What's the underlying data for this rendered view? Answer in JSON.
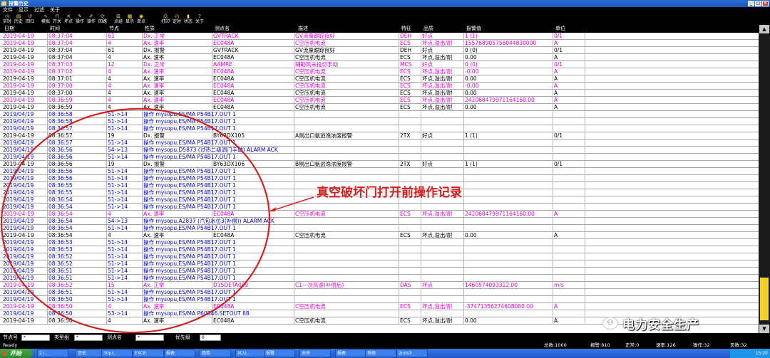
{
  "window": {
    "title": "报警历史",
    "controls": [
      "_",
      "□",
      "×"
    ]
  },
  "menu": [
    "文件",
    "显示",
    "过滤",
    "关于"
  ],
  "toolbar": [
    {
      "label": "实时",
      "icon": "realtime-icon"
    },
    {
      "label": "历史",
      "icon": "history-icon"
    },
    {
      "label": "回归",
      "icon": "replay-icon"
    },
    {
      "label": "模拟",
      "icon": "simulate-icon"
    },
    {
      "label": "开关",
      "icon": "switch-icon"
    },
    {
      "label": "坏点",
      "icon": "bad-point-icon"
    },
    {
      "label": "操作",
      "icon": "operate-icon"
    },
    {
      "label": "操作",
      "icon": "operate2-icon"
    },
    {
      "label": "回路",
      "icon": "loop-icon"
    },
    {
      "label": "点组",
      "icon": "group-icon"
    },
    {
      "label": "显示",
      "icon": "display-icon"
    },
    {
      "label": "单点",
      "icon": "single-point-icon"
    },
    {
      "label": "打印",
      "icon": "print-icon"
    },
    {
      "label": "定时",
      "icon": "timer-icon"
    },
    {
      "label": "状态",
      "icon": "status-icon"
    },
    {
      "label": "关于",
      "icon": "about-icon"
    }
  ],
  "table": {
    "columns": [
      "日期",
      "时间",
      "节点",
      "性质",
      "测点名",
      "描述",
      "特征",
      "品质",
      "报警值",
      "单位"
    ],
    "rows": [
      {
        "c": "pink",
        "v": [
          "2019-04-19",
          "08:37:04",
          "61",
          "Dx. 正常",
          "GVTRACK",
          "GV流量跟踪良好",
          "DEH",
          "好点",
          "1 (1)",
          "0/1"
        ]
      },
      {
        "c": "pink",
        "v": [
          "2019-04-19",
          "08:37:04",
          "4",
          "Ax. 速率",
          "EC048A",
          "C空压机电流",
          "ECS",
          "坏点,溢出/耐",
          "155768905756044830000",
          "A"
        ]
      },
      {
        "c": "black",
        "v": [
          "2019-04-19",
          "08:37:04",
          "61",
          "Dx. 报警",
          "GVTRACK",
          "GV流量跟踪良好",
          "DEH",
          "好点",
          "0 (0)",
          "0/1"
        ]
      },
      {
        "c": "black",
        "v": [
          "2019-04-19",
          "08:37:04",
          "4",
          "Ax. 速率",
          "EC048A",
          "C空压机电流",
          "ECS",
          "坏点,溢出/耐",
          "0.00",
          "A"
        ]
      },
      {
        "c": "pink",
        "v": [
          "2019-04-19",
          "08:37:03",
          "12",
          "Dx. 正常",
          "AAMRE",
          "辅助风未投切手动",
          "MCS",
          "好点",
          "0 (0)",
          "0/1"
        ]
      },
      {
        "c": "pink",
        "v": [
          "2019-04-19",
          "08:37:02",
          "4",
          "Ax. 速率",
          "EC048A",
          "C空压机电流",
          "ECS",
          "坏点,溢出/耐",
          "-0.00",
          "A"
        ]
      },
      {
        "c": "black",
        "v": [
          "2019-04-19",
          "08:37:01",
          "4",
          "Ax. 速率",
          "EC048A",
          "C空压机电流",
          "ECS",
          "坏点,溢出/耐",
          "0.00",
          "A"
        ]
      },
      {
        "c": "pink",
        "v": [
          "2019-04-19",
          "08:37:00",
          "4",
          "Ax. 速率",
          "EC048A",
          "C空压机电流",
          "ECS",
          "坏点,溢出/耐",
          "-0.00",
          "A"
        ]
      },
      {
        "c": "black",
        "v": [
          "2019-04-19",
          "08:37:00",
          "4",
          "Ax. 速率",
          "EC048A",
          "C空压机电流",
          "ECS",
          "坏点,溢出/耐",
          "0.00",
          "A"
        ]
      },
      {
        "c": "pink",
        "v": [
          "2019-04-19",
          "08:36:59",
          "4",
          "Ax. 速率",
          "EC048A",
          "C空压机电流",
          "ECS",
          "坏点,溢出/耐",
          "242068479971164160.00",
          "A"
        ]
      },
      {
        "c": "black",
        "v": [
          "2019-04-19",
          "08:36:59",
          "4",
          "Ax. 速率",
          "EC048A",
          "C空压机电流",
          "ECS",
          "坏点,溢出/耐",
          "0.00",
          "A"
        ]
      },
      {
        "c": "blue",
        "v": [
          "2019/04/19",
          "08:36:58",
          "51->14",
          "操作 mysopu,ES/MA P54B17.OUT 1",
          "",
          "",
          "",
          "",
          "",
          ""
        ]
      },
      {
        "c": "blue",
        "v": [
          "2019/04/19",
          "08:36:58",
          "51->14",
          "操作 mysopu,ES/MA P54B17.OUT 1",
          "",
          "",
          "",
          "",
          "",
          ""
        ]
      },
      {
        "c": "blue",
        "v": [
          "2019/04/19",
          "08:36:57",
          "51->14",
          "操作 mysopu,ES/MA P54B17.OUT 1",
          "",
          "",
          "",
          "",
          "",
          ""
        ]
      },
      {
        "c": "black",
        "v": [
          "2019-04-19",
          "08:36:57",
          "19",
          "Dx. 报警",
          "BY63DX105",
          "A侧出口氨逃逸浓度报警",
          "2TX",
          "好点",
          "1 (1)",
          "0/1"
        ]
      },
      {
        "c": "blue",
        "v": [
          "2019/04/19",
          "08:36:57",
          "51->14",
          "操作 mysopu,ES/MA P54B17.OUT 1",
          "",
          "",
          "",
          "",
          "",
          ""
        ]
      },
      {
        "c": "blue",
        "v": [
          "2019/04/19",
          "08:36:56",
          "54->13",
          "操作 mysopu,D5873 (过热二级调门手动) ALARM ACK",
          "",
          "",
          "",
          "",
          "",
          ""
        ]
      },
      {
        "c": "blue",
        "v": [
          "2019/04/19",
          "08:36:56",
          "51->14",
          "操作 mysopu,ES/MA P54B17.OUT 1",
          "",
          "",
          "",
          "",
          "",
          ""
        ]
      },
      {
        "c": "black",
        "v": [
          "2019-04-19",
          "08:36:56",
          "19",
          "Dx. 报警",
          "BY63DX106",
          "B侧出口氨逃逸浓度报警",
          "2TX",
          "好点",
          "1 (1)",
          "0/1"
        ]
      },
      {
        "c": "blue",
        "v": [
          "2019/04/19",
          "08:36:56",
          "51->14",
          "操作 mysopu,ES/MA P54B17.OUT 1",
          "",
          "",
          "",
          "",
          "",
          ""
        ]
      },
      {
        "c": "blue",
        "v": [
          "2019/04/19",
          "08:36:56",
          "51->14",
          "操作 mysopu,ES/MA P54B17.OUT 1",
          "",
          "",
          "",
          "",
          "",
          ""
        ]
      },
      {
        "c": "blue",
        "v": [
          "2019/04/19",
          "08:36:55",
          "51->14",
          "操作 mysopu,ES/MA P54B17.OUT 1",
          "",
          "",
          "",
          "",
          "",
          ""
        ]
      },
      {
        "c": "blue",
        "v": [
          "2019/04/19",
          "08:36:55",
          "51->14",
          "操作 mysopu,ES/MA P54B17.OUT 1",
          "",
          "",
          "",
          "",
          "",
          ""
        ]
      },
      {
        "c": "blue",
        "v": [
          "2019/04/19",
          "08:36:54",
          "51->14",
          "操作 mysopu,ES/MA P54B17.OUT 1",
          "",
          "",
          "",
          "",
          "",
          ""
        ]
      },
      {
        "c": "blue",
        "v": [
          "2019/04/19",
          "08:36:54",
          "51->14",
          "操作 mysopu,ES/MA P54B17.OUT 1",
          "",
          "",
          "",
          "",
          "",
          ""
        ]
      },
      {
        "c": "pink",
        "v": [
          "2019-04-19",
          "08:36:54",
          "4",
          "Ax. 速率",
          "EC048A",
          "C空压机电流",
          "ECS",
          "坏点,溢出/耐",
          "242068479971164160.00",
          "A"
        ]
      },
      {
        "c": "blue",
        "v": [
          "2019/04/19",
          "08:36:54",
          "54->13",
          "操作 mysopu,A2837 (汽包水位3(补偿)) ALARM ACK",
          "",
          "",
          "",
          "",
          "",
          ""
        ]
      },
      {
        "c": "blue",
        "v": [
          "2019/04/19",
          "08:36:54",
          "51->14",
          "操作 mysopu,ES/MA P54B17.OUT 1",
          "",
          "",
          "",
          "",
          "",
          ""
        ]
      },
      {
        "c": "black",
        "v": [
          "2019-04-19",
          "08:36:54",
          "4",
          "Ax. 速率",
          "EC048A",
          "C空压机电流",
          "ECS",
          "坏点,溢出/耐",
          "0.00",
          "A"
        ]
      },
      {
        "c": "blue",
        "v": [
          "2019/04/19",
          "08:36:53",
          "51->14",
          "操作 mysopu,ES/MA P54B17.OUT 1",
          "",
          "",
          "",
          "",
          "",
          ""
        ]
      },
      {
        "c": "blue",
        "v": [
          "2019/04/19",
          "08:36:53",
          "51->14",
          "操作 mysopu,ES/MA P54B17.OUT 1",
          "",
          "",
          "",
          "",
          "",
          ""
        ]
      },
      {
        "c": "blue",
        "v": [
          "2019/04/19",
          "08:36:52",
          "51->14",
          "操作 mysopu,ES/MA P54B17.OUT 1",
          "",
          "",
          "",
          "",
          "",
          ""
        ]
      },
      {
        "c": "blue",
        "v": [
          "2019/04/19",
          "08:36:52",
          "51->14",
          "操作 mysopu,ES/MA P54B17.OUT 1",
          "",
          "",
          "",
          "",
          "",
          ""
        ]
      },
      {
        "c": "blue",
        "v": [
          "2019/04/19",
          "08:36:51",
          "51->14",
          "操作 mysopu,ES/MA P54B17.OUT 1",
          "",
          "",
          "",
          "",
          "",
          ""
        ]
      },
      {
        "c": "blue",
        "v": [
          "2019/04/19",
          "08:36:51",
          "51->14",
          "操作 mysopu,ES/MA P54B17.OUT 1",
          "",
          "",
          "",
          "",
          "",
          ""
        ]
      },
      {
        "c": "pink",
        "v": [
          "2019-04-19",
          "08:36:52",
          "15",
          "Ax. 正常",
          "D15DETA009",
          "C1一次风速(补偿后)",
          "DAS",
          "坏点",
          "1460574093312.00",
          "m/s"
        ]
      },
      {
        "c": "blue",
        "v": [
          "2019/04/19",
          "08:36:51",
          "51->14",
          "操作 mysopu,ES/MA P54B17.OUT 1",
          "",
          "",
          "",
          "",
          "",
          ""
        ]
      },
      {
        "c": "blue",
        "v": [
          "2019/04/19",
          "08:36:50",
          "51->14",
          "操作 mysopu,ES/MA P54B17.OUT 1",
          "",
          "",
          "",
          "",
          "",
          ""
        ]
      },
      {
        "c": "pink",
        "v": [
          "2019-04-19",
          "08:36:50",
          "4",
          "Ax. 速率",
          "EC048A",
          "C空压机电流",
          "ECS",
          "坏点,溢出/耐",
          "-37471356274608080.00",
          "A"
        ]
      },
      {
        "c": "blue",
        "v": [
          "2019/04/19",
          "08:36:50",
          "53->14",
          "操作 mysopu,ES/MA P60B46.SETOUT 88",
          "",
          "",
          "",
          "",
          "",
          ""
        ]
      },
      {
        "c": "black",
        "v": [
          "2019-04-19",
          "08:36:50",
          "4",
          "Ax. 速率",
          "EC048A",
          "C空压机电流",
          "ECS",
          "坏点,溢出/耐",
          "0.00",
          "A"
        ]
      }
    ]
  },
  "filters": {
    "node_label": "节点号",
    "node_value": "*",
    "category_label": "类型组",
    "category_value": "*",
    "point_label": "测点名",
    "point_value": "*",
    "priority_label": "优先级",
    "priority_value": "0"
  },
  "status": {
    "ready": "Ready",
    "total": "总数:1000",
    "alarm": "报警:810",
    "normal": "正常:0",
    "speed": "速率:126",
    "operate": "操作:32",
    "page": "页数:32"
  },
  "taskbar": {
    "start": "开始",
    "tasks": [
      "2 I..",
      "历史",
      "30pc..",
      "EXC8",
      "报表",
      "趋势",
      "XCU..",
      "报警",
      "未命",
      "报表",
      "系统",
      "2nds3"
    ],
    "tray_time": "15:20"
  },
  "annotation": {
    "text": "真空破坏门打开前操作记录"
  },
  "watermark": {
    "text": "电力安全生产",
    "icon": "wechat-icon"
  },
  "colors": {
    "pink": "#e000d8",
    "blue": "#0000c8",
    "annotation_red": "#d62020",
    "scroll_thumb": "#f2d12a"
  }
}
